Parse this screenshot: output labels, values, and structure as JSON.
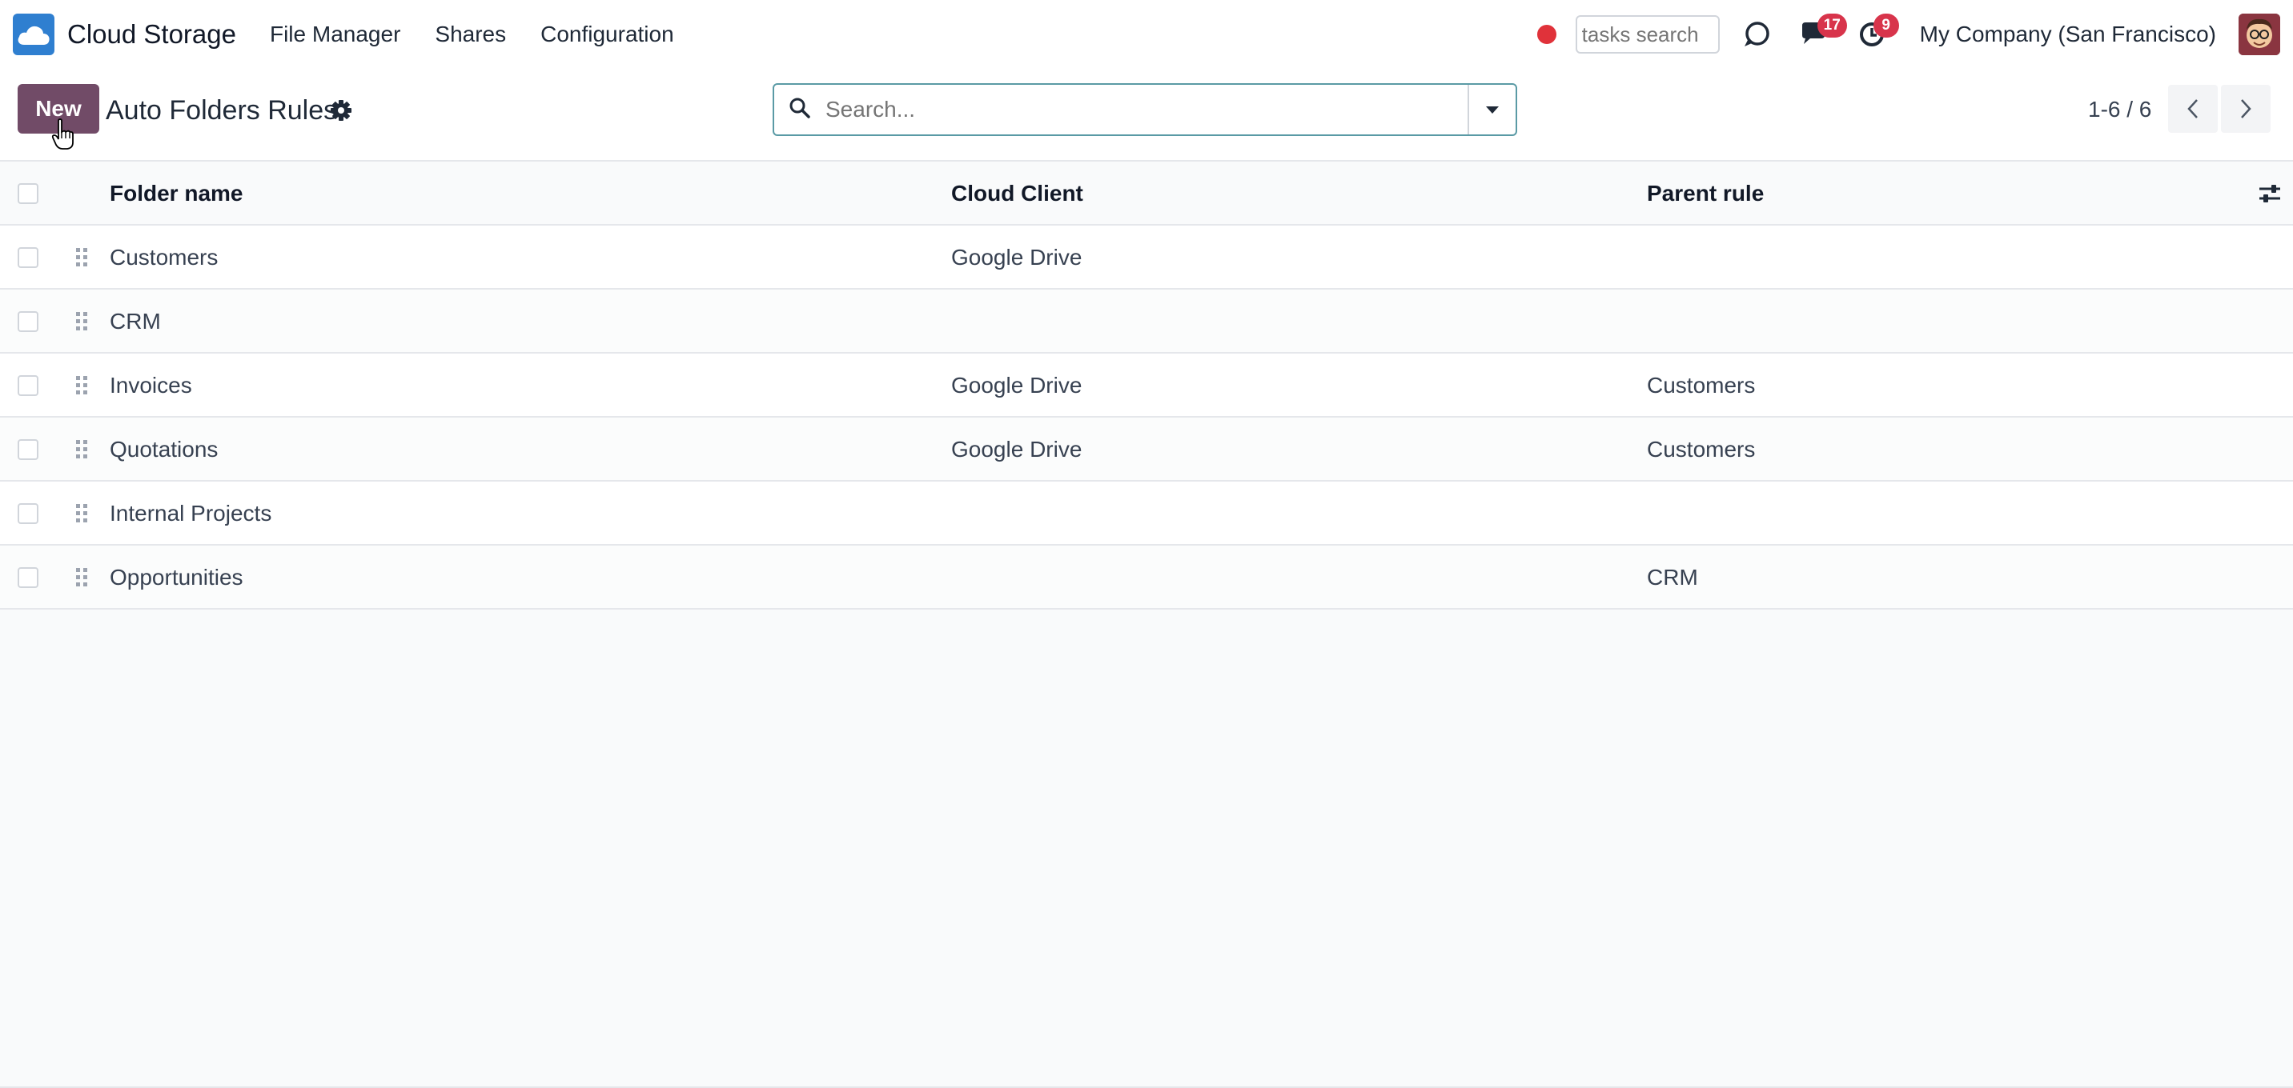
{
  "navbar": {
    "app_name": "Cloud Storage",
    "menu": [
      "File Manager",
      "Shares",
      "Configuration"
    ],
    "tasks_search_placeholder": "tasks search",
    "messages_badge": "17",
    "activities_badge": "9",
    "company": "My Company (San Francisco)",
    "icons": [
      "cloud-logo-icon",
      "record-dot-icon",
      "chat-bubble-icon",
      "messages-icon",
      "activity-clock-icon",
      "user-avatar"
    ]
  },
  "control_panel": {
    "new_label": "New",
    "title": "Auto Folders Rules",
    "search_placeholder": "Search...",
    "pager": "1-6 / 6"
  },
  "table": {
    "columns": [
      "Folder name",
      "Cloud Client",
      "Parent rule"
    ],
    "rows": [
      {
        "name": "Customers",
        "client": "Google Drive",
        "parent": ""
      },
      {
        "name": "CRM",
        "client": "",
        "parent": ""
      },
      {
        "name": "Invoices",
        "client": "Google Drive",
        "parent": "Customers"
      },
      {
        "name": "Quotations",
        "client": "Google Drive",
        "parent": "Customers"
      },
      {
        "name": "Internal Projects",
        "client": "",
        "parent": ""
      },
      {
        "name": "Opportunities",
        "client": "",
        "parent": "CRM"
      }
    ]
  },
  "colors": {
    "primary": "#714b67",
    "badge": "#d8344b",
    "record": "#e0323a",
    "search_border": "#5a9aa5"
  }
}
